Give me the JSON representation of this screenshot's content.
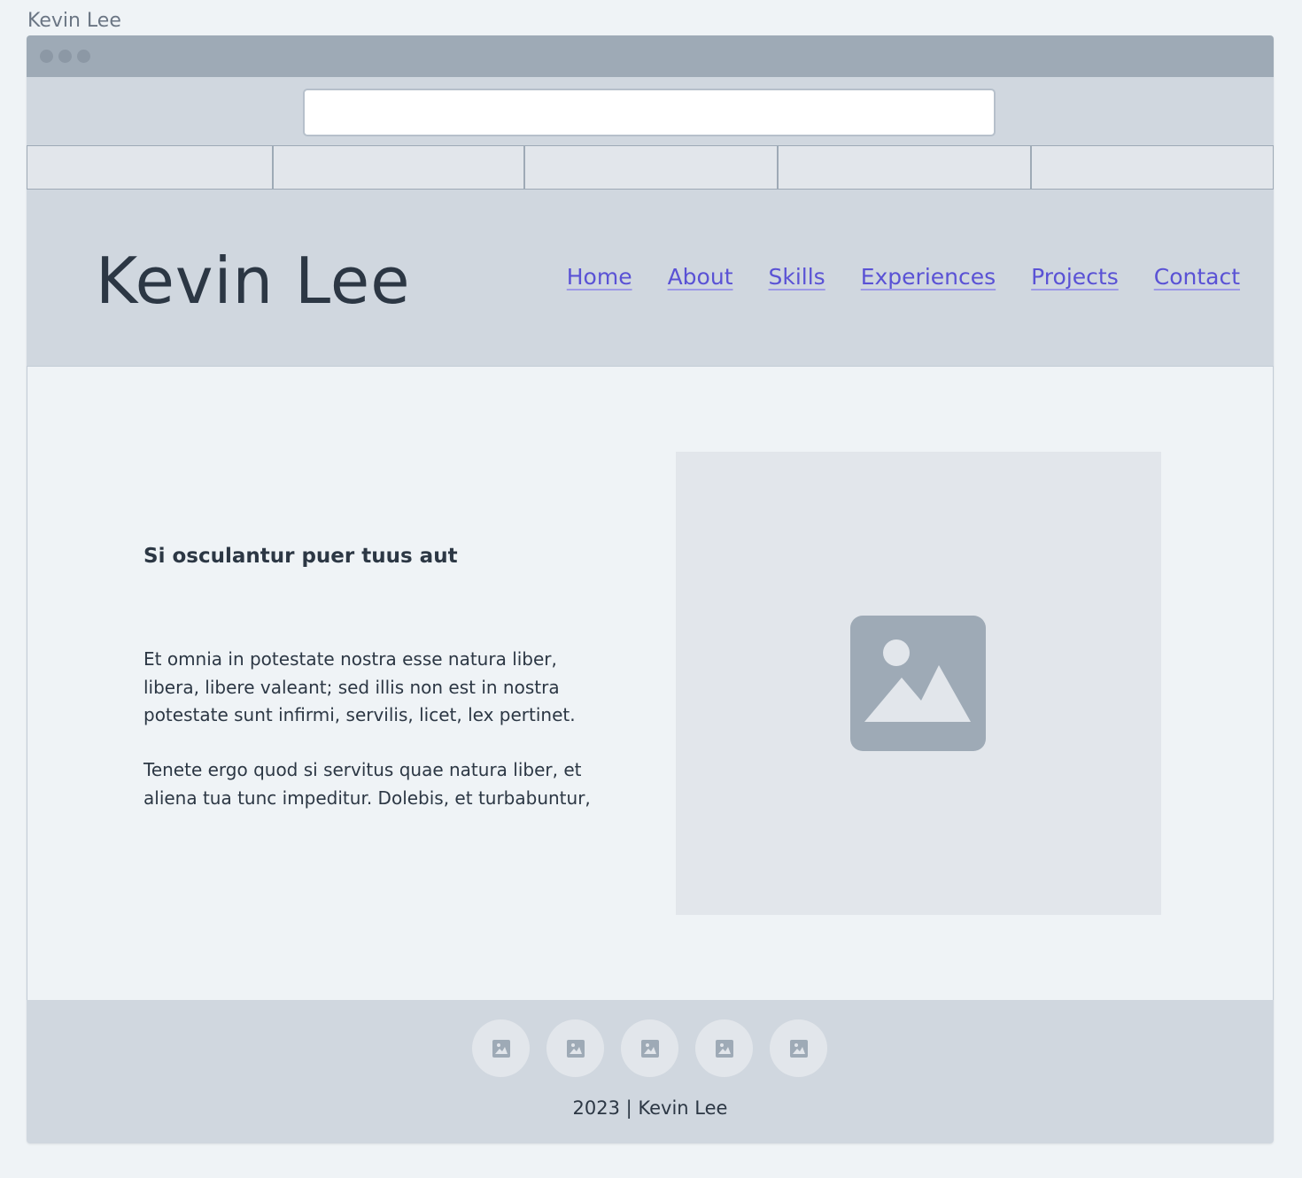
{
  "frame": {
    "label": "Kevin Lee"
  },
  "browser": {
    "address_value": "",
    "tab_count": 5
  },
  "header": {
    "title": "Kevin Lee",
    "nav": [
      "Home",
      "About",
      "Skills",
      "Experiences",
      "Projects",
      "Contact"
    ]
  },
  "main": {
    "heading": "Si osculantur puer tuus aut",
    "paragraphs": [
      "Et omnia in potestate nostra esse natura liber, libera, libere valeant; sed illis non est in nostra potestate sunt infirmi, servilis, licet, lex pertinet.",
      "Tenete ergo quod si servitus quae natura liber, et aliena tua tunc impeditur. Dolebis, et turbabuntur,"
    ],
    "image_icon": "image-placeholder-icon"
  },
  "footer": {
    "social_icons": [
      "image-icon",
      "image-icon",
      "image-icon",
      "image-icon",
      "image-icon"
    ],
    "copyright": "2023 | Kevin Lee"
  },
  "colors": {
    "background": "#eff3f6",
    "chrome": "#d0d7df",
    "titlebar": "#9eaab6",
    "link": "#5a52d5",
    "text": "#2c3744"
  }
}
